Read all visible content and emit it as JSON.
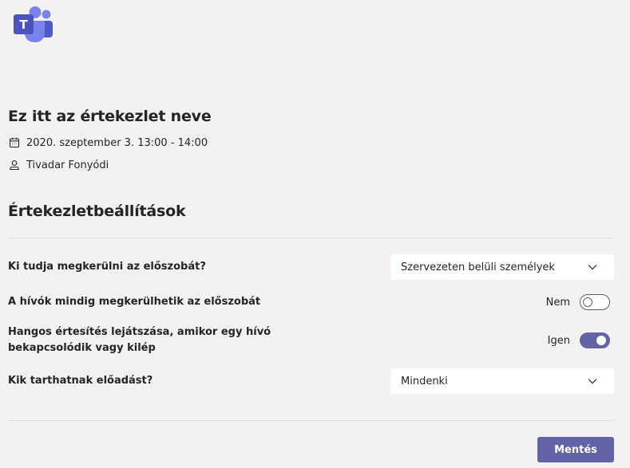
{
  "app": {
    "logo_icon": "microsoft-teams-logo",
    "logo_letter": "T",
    "accent_color": "#6264a7"
  },
  "meeting": {
    "title": "Ez itt az értekezlet neve",
    "datetime": "2020. szeptember 3. 13:00 - 14:00",
    "datetime_icon": "calendar-icon",
    "organizer": "Tivadar Fonyódi",
    "organizer_icon": "person-icon"
  },
  "settings": {
    "section_title": "Értekezletbeállítások",
    "lobby_bypass": {
      "label": "Ki tudja megkerülni az előszobát?",
      "value": "Szervezeten belüli személyek",
      "icon": "chevron-down-icon"
    },
    "callers_bypass": {
      "label": "A hívók mindig megkerülhetik az előszobát",
      "state_label": "Nem",
      "checked": false
    },
    "join_sound": {
      "label": "Hangos értesítés lejátszása, amikor egy hívó bekapcsolódik vagy kilép",
      "state_label": "Igen",
      "checked": true
    },
    "presenters": {
      "label": "Kik tarthatnak előadást?",
      "value": "Mindenki",
      "icon": "chevron-down-icon"
    }
  },
  "footer": {
    "save_label": "Mentés"
  }
}
